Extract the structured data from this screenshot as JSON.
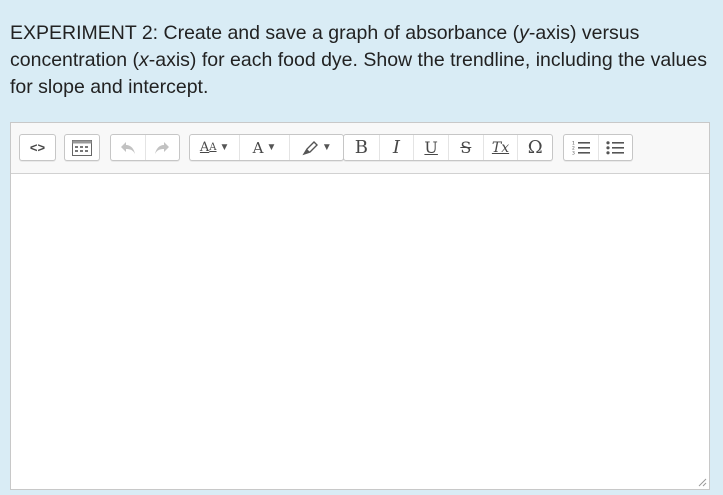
{
  "question": {
    "part1": "EXPERIMENT 2: Create and save a graph of absorbance (",
    "ital1": "y",
    "part2": "-axis) versus concentration (",
    "ital2": "x",
    "part3": "-axis) for each food dye. Show the trendline, including the values for slope and intercept."
  },
  "toolbar": {
    "source": "<>",
    "font_size": "A",
    "text_color": "A",
    "bold": "B",
    "italic": "I",
    "underline": "U",
    "strikethrough": "S",
    "remove_format": "Tx",
    "special_char": "Ω"
  },
  "editor": {
    "content": ""
  },
  "colors": {
    "background": "#d9ecf5",
    "toolbar": "#f8f8f8",
    "border": "#c8c8c8"
  }
}
